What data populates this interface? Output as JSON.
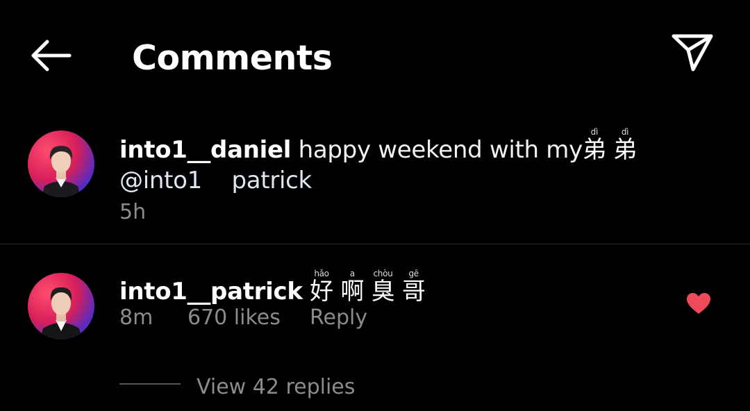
{
  "header": {
    "title": "Comments",
    "back_icon": "arrow-left-icon",
    "share_icon": "paper-plane-icon"
  },
  "comments": [
    {
      "username": "into1__daniel",
      "text": "happy weekend with my",
      "ruby": [
        {
          "char": "弟",
          "pinyin": "dì"
        },
        {
          "char": "弟",
          "pinyin": "dì"
        }
      ],
      "mention": "@into1",
      "mention_tail": "patrick",
      "time": "5h"
    },
    {
      "username": "into1__patrick",
      "ruby": [
        {
          "char": "好",
          "pinyin": "hǎo"
        },
        {
          "char": "啊",
          "pinyin": "a"
        },
        {
          "char": "臭",
          "pinyin": "chòu"
        },
        {
          "char": "哥",
          "pinyin": "gē"
        }
      ],
      "time": "8m",
      "likes": "670 likes",
      "reply_label": "Reply",
      "view_replies": "View 42 replies",
      "liked": true
    }
  ],
  "colors": {
    "background": "#000000",
    "heart": "#ef4a5a",
    "meta": "#8c8c8c"
  }
}
